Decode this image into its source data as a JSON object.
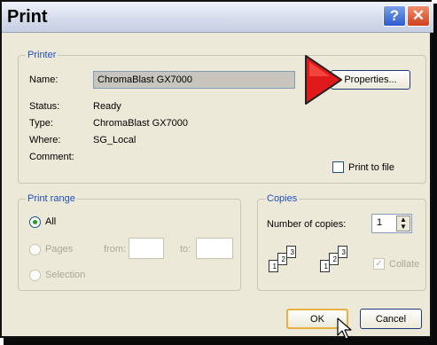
{
  "window": {
    "title": "Print"
  },
  "printer": {
    "legend": "Printer",
    "name_label": "Name:",
    "name_value": "ChromaBlast GX7000",
    "properties_label": "Properties...",
    "status_label": "Status:",
    "status_value": "Ready",
    "type_label": "Type:",
    "type_value": "ChromaBlast GX7000",
    "where_label": "Where:",
    "where_value": "SG_Local",
    "comment_label": "Comment:",
    "print_to_file_label": "Print to file"
  },
  "print_range": {
    "legend": "Print range",
    "all_label": "All",
    "pages_label": "Pages",
    "from_label": "from:",
    "to_label": "to:",
    "selection_label": "Selection"
  },
  "copies": {
    "legend": "Copies",
    "number_label": "Number of copies:",
    "number_value": "1",
    "collate_label": "Collate",
    "page_numbers": [
      "1",
      "2",
      "3"
    ]
  },
  "buttons": {
    "ok": "OK",
    "cancel": "Cancel"
  },
  "colors": {
    "accent": "#1f4fc0",
    "arrow": "#e01a1a",
    "close": "#d0401c"
  }
}
